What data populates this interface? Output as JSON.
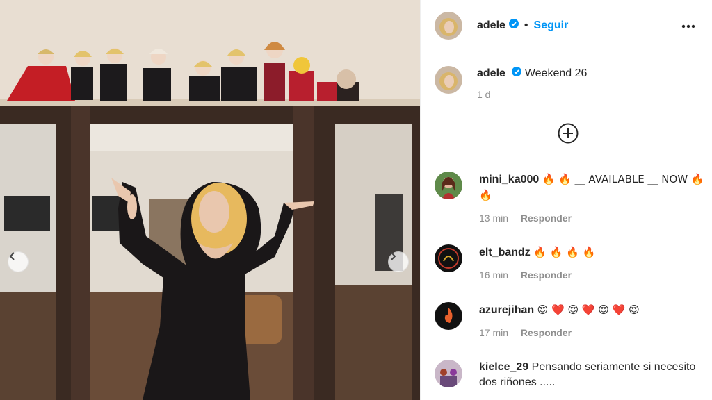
{
  "photo": {
    "alt": "",
    "prev_icon": "chevron-left-icon",
    "next_icon": "chevron-right-icon"
  },
  "post": {
    "username": "adele",
    "follow_label": "Seguir",
    "separator": "•",
    "more_icon": "more-horizontal-icon",
    "caption_text": "Weekend 26",
    "caption_time": "1 d",
    "load_more_icon": "plus-circle-icon"
  },
  "comments": [
    {
      "username": "mini_ka000",
      "text": "🔥 🔥 __ AVAILABLE __ NOW 🔥 🔥",
      "time": "13 min",
      "reply": "Responder"
    },
    {
      "username": "elt_bandz",
      "text": "🔥 🔥 🔥 🔥",
      "time": "16 min",
      "reply": "Responder"
    },
    {
      "username": "azurejihan",
      "text": "😍 ❤️ 😍 ❤️ 😍 ❤️ 😍",
      "time": "17 min",
      "reply": "Responder"
    },
    {
      "username": "kielce_29",
      "text": "Pensando seriamente si necesito dos riñones .....",
      "time": "",
      "reply": ""
    }
  ],
  "colors": {
    "link": "#0095f6",
    "verified": "#0095f6",
    "muted": "#8e8e8e"
  }
}
